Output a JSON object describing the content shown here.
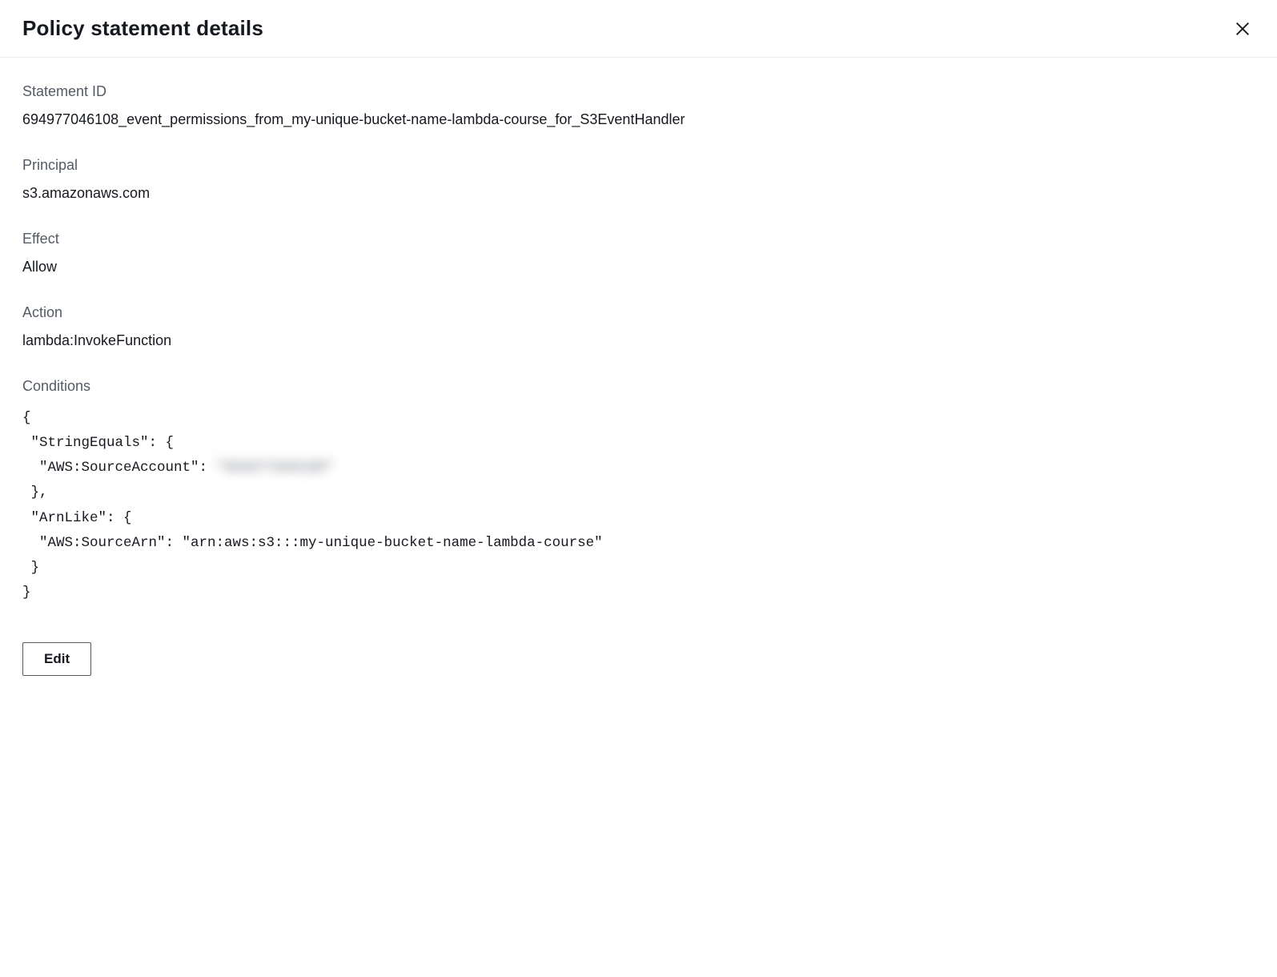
{
  "modal": {
    "title": "Policy statement details",
    "fields": {
      "statement_id": {
        "label": "Statement ID",
        "value": "694977046108_event_permissions_from_my-unique-bucket-name-lambda-course_for_S3EventHandler"
      },
      "principal": {
        "label": "Principal",
        "value": "s3.amazonaws.com"
      },
      "effect": {
        "label": "Effect",
        "value": "Allow"
      },
      "action": {
        "label": "Action",
        "value": "lambda:InvokeFunction"
      },
      "conditions": {
        "label": "Conditions",
        "line1": "{",
        "line2": " \"StringEquals\": {",
        "line3a": "  \"AWS:SourceAccount\": ",
        "line3b_redacted": "\"694977046108\"",
        "line4": " },",
        "line5": " \"ArnLike\": {",
        "line6": "  \"AWS:SourceArn\": \"arn:aws:s3:::my-unique-bucket-name-lambda-course\"",
        "line7": " }",
        "line8": "}"
      }
    },
    "buttons": {
      "edit": "Edit"
    }
  }
}
